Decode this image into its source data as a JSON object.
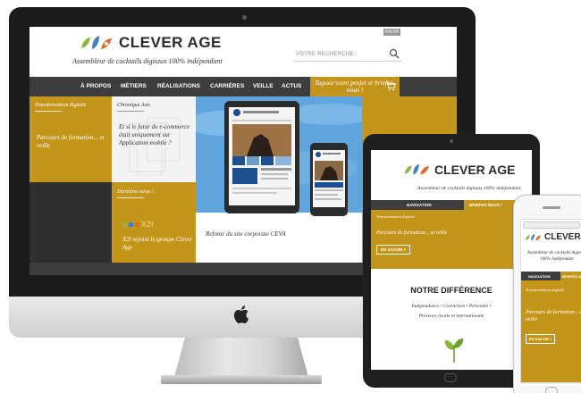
{
  "colors": {
    "gold": "#c4951b",
    "nav_dark": "#3d3d3d",
    "device_black": "#1b1b1b",
    "sky_blue": "#5fa4dc"
  },
  "icons": [
    "leaf-logo-icon",
    "search-icon",
    "cart-icon",
    "apple-logo-icon"
  ],
  "desktop": {
    "brand": "CLEVER AGE",
    "tagline": "Assembleur de cocktails digitaux 100% indépendant",
    "lang": "EN FR",
    "search_placeholder": "VOTRE RECHERCHE :",
    "nav": [
      "À PROPOS",
      "MÉTIERS",
      "RÉALISATIONS",
      "CARRIÈRES",
      "VEILLE",
      "ACTUS"
    ],
    "cta": "Taguez votre projet et briefez-nous !",
    "tiles": {
      "t1_kicker": "Transformation digitale",
      "t1_text": "Parcours de formation... et veille",
      "t2_kicker": "Chronique Asie",
      "t2_text": "Et si le futur du e-commerce était uniquement sur Application mobile ?",
      "t3_caption": "Refonte du site corporate CEVA",
      "t5_kicker": "Dernières news !",
      "t5_text": "X2i rejoint le groupe Clever Age",
      "t5_logo": "X2i"
    }
  },
  "tablet": {
    "brand": "CLEVER AGE",
    "tagline": "Assembleur de cocktails digitaux 100% indépendant",
    "nav_label": "NAVIGATION",
    "nav_cta": "BRIEFEZ-NOUS !",
    "kicker": "Transformation digitale",
    "text": "Parcours de formation... et veille",
    "more": "EN SAVOIR +",
    "heading": "NOTRE DIFFÉRENCE",
    "values_line1": "Indépendance • Conviction • Pérennité •",
    "values_line2": "Présence locale et internationale"
  },
  "phone": {
    "brand": "CLEVER AGE",
    "tagline": "Assembleur de cocktails digitaux 100% indépendant",
    "nav_label": "NAVIGATION",
    "nav_cta": "BRIEFEZ-NOUS",
    "kicker": "Transformation digitale",
    "text": "Parcours de formation... et veille",
    "more": "EN SAVOIR +"
  }
}
